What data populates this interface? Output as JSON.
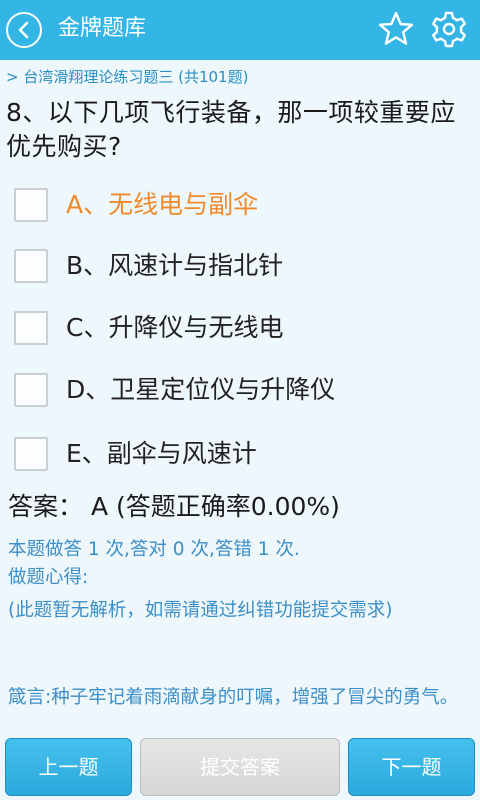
{
  "header": {
    "title": "金牌题库",
    "back_icon": "back-circle-icon",
    "star_icon": "star-outline-icon",
    "settings_icon": "gear-icon",
    "background": "#33b5e5"
  },
  "breadcrumb": "> 台湾滑翔理论练习题三 (共101题)",
  "question": "8、以下几项飞行装备，那一项较重要应优先购买?",
  "options": [
    {
      "label": "A、无线电与副伞"
    },
    {
      "label": "B、风速计与指北针"
    },
    {
      "label": "C、升降仪与无线电"
    },
    {
      "label": "D、卫星定位仪与升降仪"
    },
    {
      "label": "E、副伞与风速计"
    }
  ],
  "answer": "答案：  A  (答题正确率0.00%)",
  "stats": "本题做答 1 次,答对 0 次,答错 1 次.",
  "notes_label": "做题心得:",
  "notes_text": "(此题暂无解析，如需请通过纠错功能提交需求)",
  "motto": "箴言:种子牢记着雨滴献身的叮嘱，增强了冒尖的勇气。",
  "buttons": {
    "prev": "上一题",
    "submit": "提交答案",
    "next": "下一题"
  },
  "colors": {
    "accent": "#33b5e5",
    "highlight_option": "#f08a2c",
    "info_text": "#3d8fc8"
  }
}
